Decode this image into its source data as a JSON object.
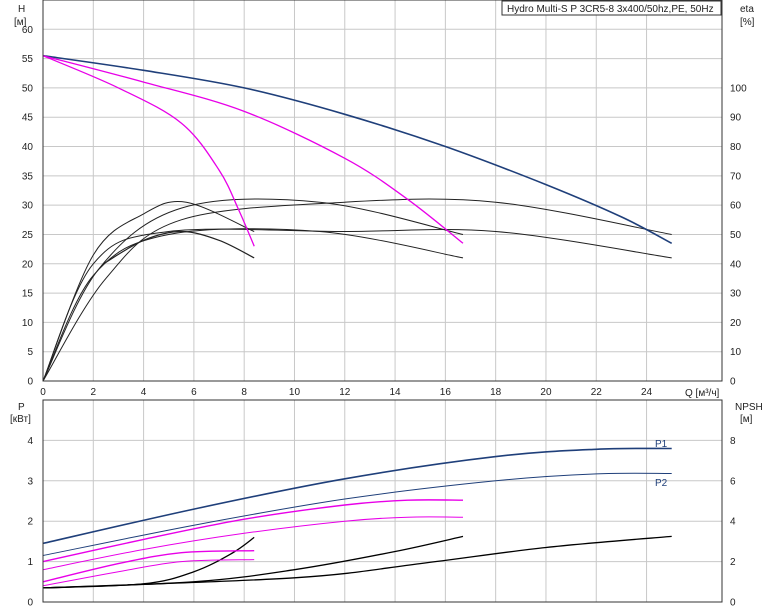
{
  "title": "Hydro Multi-S P 3CR5-8 3x400/50hz,PE, 50Hz",
  "chart_data": [
    {
      "type": "line",
      "panel": "head-efficiency",
      "xlabel": "Q [м³/ч]",
      "ylabel": "H",
      "ylabel_unit": "[м]",
      "y2label": "eta",
      "y2label_unit": "[%]",
      "xlim": [
        0,
        27
      ],
      "ylim": [
        0,
        65
      ],
      "y2lim": [
        0,
        130
      ],
      "xticks": [
        "0",
        "2",
        "4",
        "6",
        "8",
        "10",
        "12",
        "14",
        "16",
        "18",
        "20",
        "22",
        "24"
      ],
      "yticks": [
        "0",
        "5",
        "10",
        "15",
        "20",
        "25",
        "30",
        "35",
        "40",
        "45",
        "50",
        "55",
        "60"
      ],
      "y2ticks": [
        "0",
        "10",
        "20",
        "30",
        "40",
        "50",
        "60",
        "70",
        "80",
        "90",
        "100"
      ],
      "grid": true,
      "head_curves": [
        {
          "color": "#1f3f7a",
          "width": 1.6,
          "points": [
            [
              0,
              55.5
            ],
            [
              4,
              53
            ],
            [
              8,
              50
            ],
            [
              12,
              45.5
            ],
            [
              16,
              40
            ],
            [
              20,
              33.5
            ],
            [
              23,
              28
            ],
            [
              25,
              23.5
            ]
          ]
        },
        {
          "color": "#e800e8",
          "width": 1.3,
          "points": [
            [
              0,
              55.5
            ],
            [
              4,
              51
            ],
            [
              8,
              46
            ],
            [
              12,
              38
            ],
            [
              14.5,
              31
            ],
            [
              16.7,
              23.5
            ]
          ]
        },
        {
          "color": "#e800e8",
          "width": 1.3,
          "points": [
            [
              0,
              55.5
            ],
            [
              3,
              50
            ],
            [
              5.5,
              44
            ],
            [
              7,
              36
            ],
            [
              7.8,
              29
            ],
            [
              8.4,
              23
            ]
          ]
        }
      ],
      "efficiency_curves": [
        {
          "color": "#222222",
          "width": 1.0,
          "points": [
            [
              0,
              0
            ],
            [
              2.5,
              35
            ],
            [
              5.5,
              55
            ],
            [
              12,
              61
            ],
            [
              18,
              61
            ],
            [
              25,
              50
            ]
          ]
        },
        {
          "color": "#222222",
          "width": 1.0,
          "points": [
            [
              0,
              0
            ],
            [
              2,
              40
            ],
            [
              5,
              51
            ],
            [
              12,
              51
            ],
            [
              18,
              51
            ],
            [
              25,
              42
            ]
          ]
        },
        {
          "color": "#222222",
          "width": 1.0,
          "points": [
            [
              0,
              0
            ],
            [
              2.2,
              38
            ],
            [
              5.5,
              59
            ],
            [
              11,
              61
            ],
            [
              16.7,
              50
            ]
          ]
        },
        {
          "color": "#222222",
          "width": 1.0,
          "points": [
            [
              0,
              0
            ],
            [
              2,
              36
            ],
            [
              5,
              50
            ],
            [
              11,
              51
            ],
            [
              16.7,
              42
            ]
          ]
        },
        {
          "color": "#222222",
          "width": 1.0,
          "points": [
            [
              0,
              0
            ],
            [
              2,
              43
            ],
            [
              4,
              57
            ],
            [
              5.7,
              61
            ],
            [
              8.4,
              51
            ]
          ]
        },
        {
          "color": "#222222",
          "width": 1.2,
          "points": [
            [
              2.4,
              40
            ],
            [
              4,
              48
            ],
            [
              5.5,
              51
            ],
            [
              7,
              48
            ],
            [
              8.4,
              42
            ]
          ]
        }
      ]
    },
    {
      "type": "line",
      "panel": "power-npsh",
      "ylabel": "P",
      "ylabel_unit": "[кВт]",
      "y2label": "NPSH",
      "y2label_unit": "[м]",
      "xlim": [
        0,
        27
      ],
      "ylim": [
        0,
        5
      ],
      "y2lim": [
        0,
        10
      ],
      "yticks": [
        "0",
        "1",
        "2",
        "3",
        "4"
      ],
      "y2ticks": [
        "0",
        "2",
        "4",
        "6",
        "8"
      ],
      "grid": true,
      "series_labels": [
        "P1",
        "P2"
      ],
      "power_curves": [
        {
          "name": "P1",
          "color": "#1f3f7a",
          "width": 1.6,
          "points": [
            [
              0,
              1.45
            ],
            [
              6,
              2.3
            ],
            [
              12,
              3.05
            ],
            [
              18,
              3.6
            ],
            [
              22,
              3.78
            ],
            [
              25,
              3.8
            ]
          ]
        },
        {
          "name": "P2",
          "color": "#1f3f7a",
          "width": 1.0,
          "points": [
            [
              0,
              1.15
            ],
            [
              6,
              1.9
            ],
            [
              12,
              2.55
            ],
            [
              18,
              3.0
            ],
            [
              22,
              3.17
            ],
            [
              25,
              3.18
            ]
          ]
        },
        {
          "color": "#e800e8",
          "width": 1.4,
          "points": [
            [
              0,
              1.0
            ],
            [
              4,
              1.55
            ],
            [
              8,
              2.05
            ],
            [
              12,
              2.4
            ],
            [
              14.5,
              2.52
            ],
            [
              16.7,
              2.52
            ]
          ]
        },
        {
          "color": "#e800e8",
          "width": 1.0,
          "points": [
            [
              0,
              0.8
            ],
            [
              4,
              1.3
            ],
            [
              8,
              1.7
            ],
            [
              12,
              2.0
            ],
            [
              14.5,
              2.1
            ],
            [
              16.7,
              2.1
            ]
          ]
        },
        {
          "color": "#e800e8",
          "width": 1.4,
          "points": [
            [
              0,
              0.5
            ],
            [
              3,
              0.95
            ],
            [
              5.5,
              1.22
            ],
            [
              8.4,
              1.27
            ]
          ]
        },
        {
          "color": "#e800e8",
          "width": 1.0,
          "points": [
            [
              0,
              0.4
            ],
            [
              3,
              0.75
            ],
            [
              5.5,
              1.0
            ],
            [
              8.4,
              1.05
            ]
          ]
        }
      ],
      "npsh_curves": [
        {
          "color": "#000000",
          "width": 1.3,
          "points": [
            [
              0,
              0.7
            ],
            [
              10,
              1.2
            ],
            [
              15,
              1.9
            ],
            [
              20,
              2.7
            ],
            [
              25,
              3.25
            ]
          ]
        },
        {
          "color": "#000000",
          "width": 1.3,
          "points": [
            [
              0,
              0.7
            ],
            [
              6,
              1.0
            ],
            [
              10,
              1.6
            ],
            [
              14,
              2.5
            ],
            [
              16.7,
              3.25
            ]
          ]
        },
        {
          "color": "#000000",
          "width": 1.3,
          "points": [
            [
              0,
              0.7
            ],
            [
              4,
              0.9
            ],
            [
              6,
              1.5
            ],
            [
              7.5,
              2.4
            ],
            [
              8.4,
              3.2
            ]
          ]
        }
      ]
    }
  ]
}
